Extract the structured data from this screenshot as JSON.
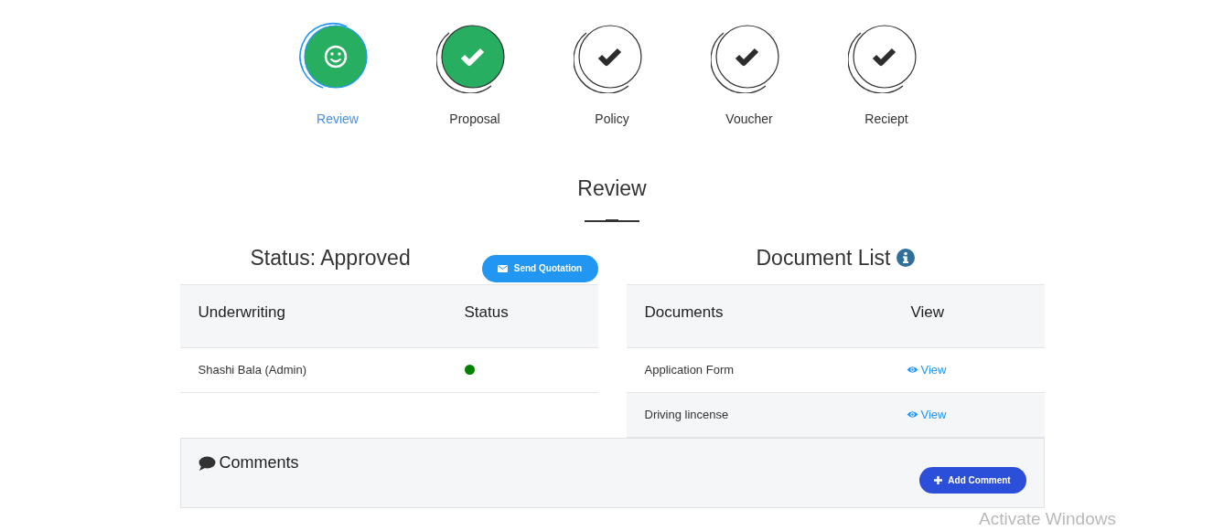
{
  "steps": [
    {
      "label": "Review",
      "kind": "smiley",
      "selected": true,
      "completed": true
    },
    {
      "label": "Proposal",
      "kind": "check",
      "selected": false,
      "completed": true
    },
    {
      "label": "Policy",
      "kind": "check",
      "selected": false,
      "completed": false
    },
    {
      "label": "Voucher",
      "kind": "check",
      "selected": false,
      "completed": false
    },
    {
      "label": "Reciept",
      "kind": "check",
      "selected": false,
      "completed": false
    }
  ],
  "section_title": "Review",
  "status_panel": {
    "title": "Status: Approved",
    "button": "Send Quotation",
    "columns": [
      "Underwriting",
      "Status"
    ],
    "rows": [
      {
        "name": "Shashi Bala (Admin)",
        "color": "#008000"
      }
    ]
  },
  "document_panel": {
    "title": "Document List",
    "columns": [
      "Documents",
      "View"
    ],
    "rows": [
      {
        "name": "Application Form",
        "link": "View"
      },
      {
        "name": "Driving lincense",
        "link": "View"
      }
    ]
  },
  "comments": {
    "title": "Comments",
    "button": "Add Comment"
  },
  "overlay": "Activate Windows"
}
